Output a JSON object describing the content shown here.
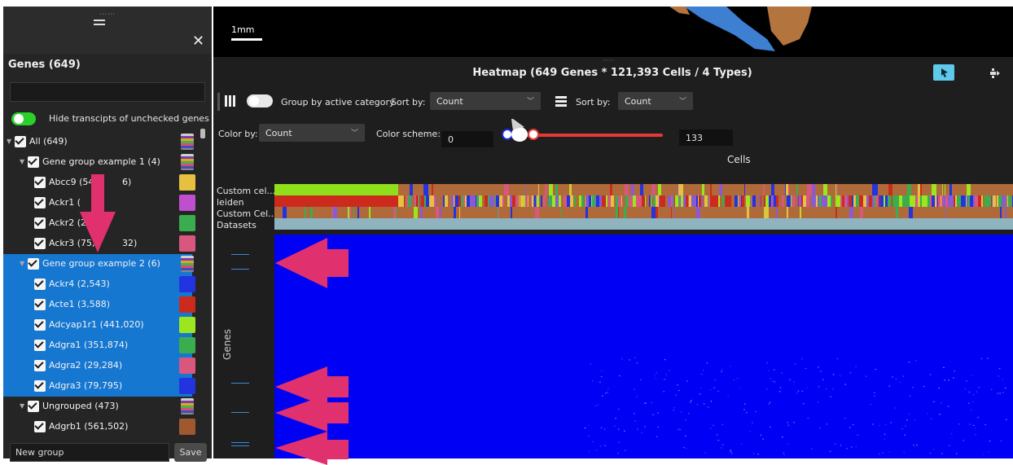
{
  "colors": {
    "selection_blue": "#1677d1",
    "toggle_green": "#2bd12b",
    "heatmap_blue": "#0000f5",
    "annotation_arrow": "#e0306e"
  },
  "spatial_view": {
    "scale_label": "1mm"
  },
  "gene_panel": {
    "title": "Genes (649)",
    "search_placeholder": "",
    "hide_toggle_label": "Hide transcipts of unchecked genes",
    "tree": [
      {
        "label": "All (649)",
        "level": 0,
        "caret": true,
        "selected": false,
        "swatch": "multi"
      },
      {
        "label": "Gene group example 1 (4)",
        "level": 1,
        "caret": true,
        "selected": false,
        "swatch": "multi"
      },
      {
        "label": "Abcc9 (54",
        "suffix": "6)",
        "level": 2,
        "caret": false,
        "selected": false,
        "swatch": "#e6c040"
      },
      {
        "label": "Ackr1 (",
        "suffix": "",
        "level": 2,
        "caret": false,
        "selected": false,
        "swatch": "#c04fcf"
      },
      {
        "label": "Ackr2 (21",
        "suffix": "",
        "level": 2,
        "caret": false,
        "selected": false,
        "swatch": "#3aad4f"
      },
      {
        "label": "Ackr3 (75,",
        "suffix": "32)",
        "level": 2,
        "caret": false,
        "selected": false,
        "swatch": "#d9577f"
      },
      {
        "label": "Gene group example 2 (6)",
        "level": 1,
        "caret": true,
        "selected": true,
        "swatch": "multi"
      },
      {
        "label": "Ackr4 (2,543)",
        "level": 2,
        "caret": false,
        "selected": true,
        "swatch": "#2233e0"
      },
      {
        "label": "Acte1 (3,588)",
        "level": 2,
        "caret": false,
        "selected": true,
        "swatch": "#cc2a1c"
      },
      {
        "label": "Adcyap1r1 (441,020)",
        "level": 2,
        "caret": false,
        "selected": true,
        "swatch": "#9be61e"
      },
      {
        "label": "Adgra1 (351,874)",
        "level": 2,
        "caret": false,
        "selected": true,
        "swatch": "#3aad4f"
      },
      {
        "label": "Adgra2 (29,284)",
        "level": 2,
        "caret": false,
        "selected": true,
        "swatch": "#d9577f"
      },
      {
        "label": "Adgra3 (79,795)",
        "level": 2,
        "caret": false,
        "selected": true,
        "swatch": "#2233e0"
      },
      {
        "label": "Ungrouped (473)",
        "level": 1,
        "caret": true,
        "selected": false,
        "swatch": "multi"
      },
      {
        "label": "Adgrb1 (561,502)",
        "level": 2,
        "caret": false,
        "selected": false,
        "swatch": "#a0582e"
      }
    ],
    "new_group_value": "New group",
    "save_label": "Save"
  },
  "heatmap_panel": {
    "title": "Heatmap (649 Genes * 121,393 Cells / 4 Types)",
    "group_by_label": "Group by active category",
    "sort_by_label_1": "Sort by:",
    "sort_by_value_1": "Count",
    "sort_by_label_2": "Sort by:",
    "sort_by_value_2": "Count",
    "color_by_label": "Color by:",
    "color_by_value": "Count",
    "color_scheme_label": "Color scheme:",
    "range_min": "0",
    "range_max": "133",
    "cells_axis_label": "Cells",
    "genes_axis_label": "Genes",
    "track_labels": [
      "Custom cel...",
      "leiden",
      "Custom Cel...",
      "Datasets"
    ]
  }
}
